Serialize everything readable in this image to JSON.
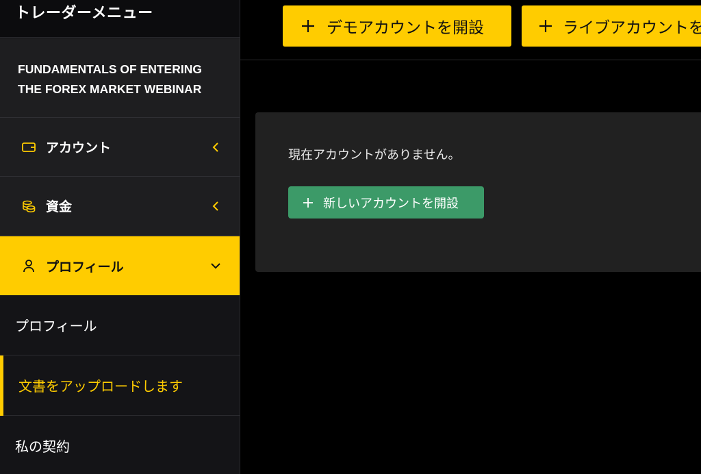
{
  "sidebar": {
    "menu_title": "トレーダーメニュー",
    "promo_line1": "FUNDAMENTALS OF ENTERING",
    "promo_line2": "THE FOREX MARKET WEBINAR",
    "nav": [
      {
        "label": "アカウント",
        "icon": "wallet-icon",
        "state": "collapsed"
      },
      {
        "label": "資金",
        "icon": "coins-icon",
        "state": "collapsed"
      },
      {
        "label": "プロフィール",
        "icon": "user-icon",
        "state": "expanded"
      }
    ],
    "sub_items": [
      {
        "label": "プロフィール"
      },
      {
        "label": "文書をアップロードします",
        "current": true
      },
      {
        "label": "私の契約"
      }
    ]
  },
  "topbar": {
    "demo_button": "デモアカウントを開設",
    "live_button": "ライブアカウントを開設"
  },
  "main": {
    "empty_message": "現在アカウントがありません。",
    "open_new_button": "新しいアカウントを開設"
  },
  "colors": {
    "accent": "#ffcc00",
    "sidebar_bg": "#141417",
    "panel_bg": "#1e1e20",
    "card_bg": "#212121",
    "success": "#3c9a68"
  }
}
